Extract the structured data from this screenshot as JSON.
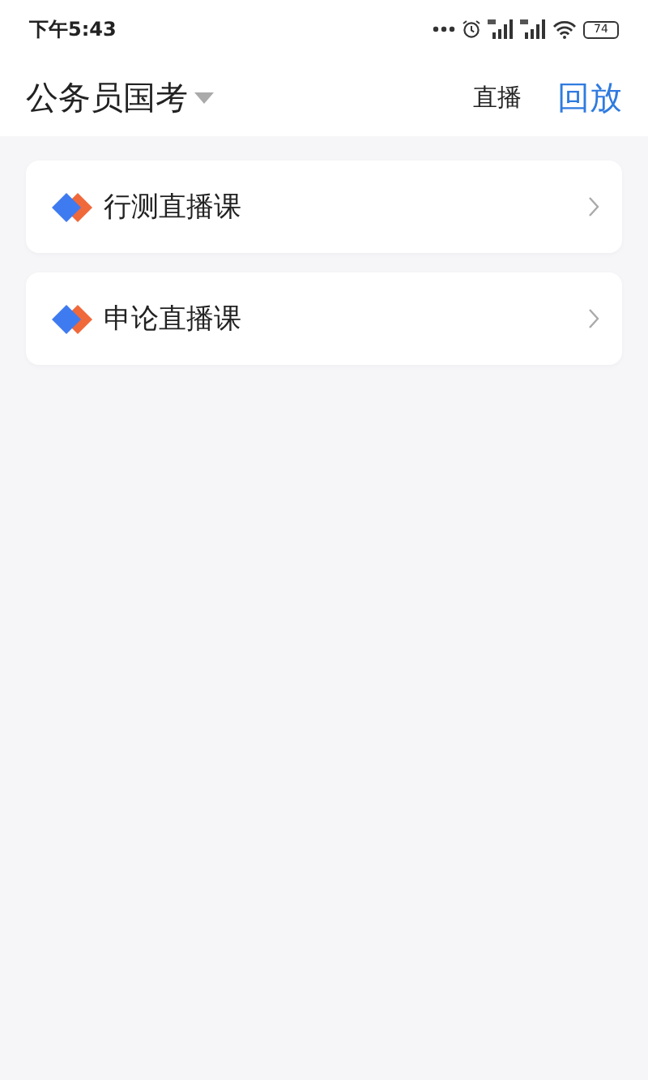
{
  "status_bar": {
    "time": "下午5:43",
    "battery": "74"
  },
  "header": {
    "title": "公务员国考",
    "tabs": [
      {
        "label": "直播",
        "selected": false
      },
      {
        "label": "回放",
        "selected": true
      }
    ]
  },
  "courses": [
    {
      "title": "行测直播课"
    },
    {
      "title": "申论直播课"
    }
  ]
}
